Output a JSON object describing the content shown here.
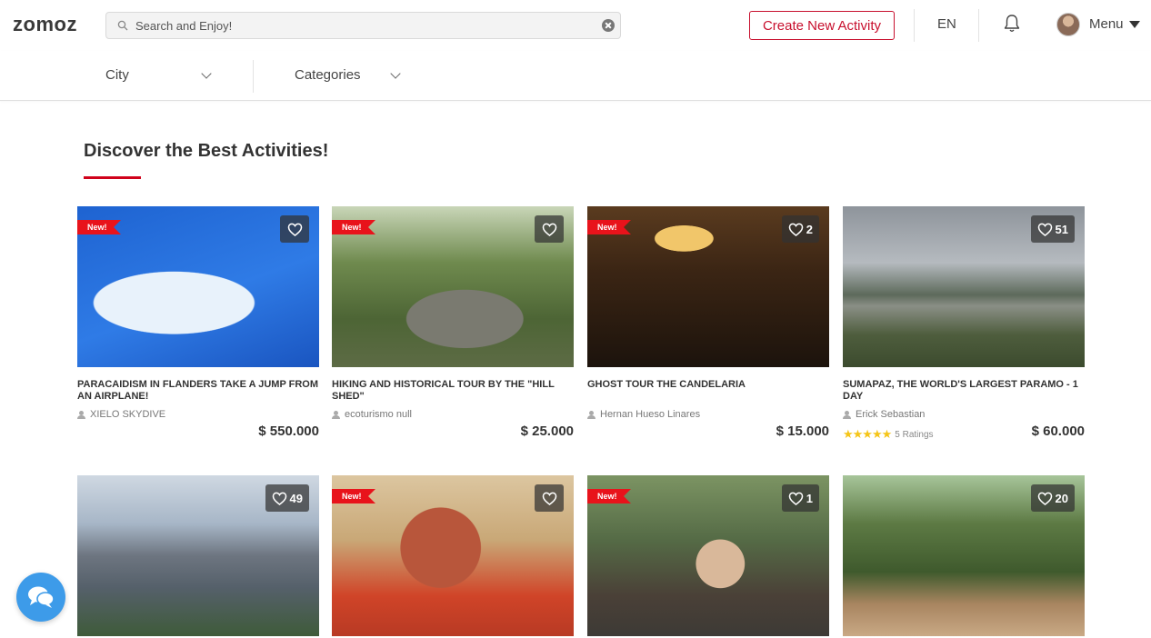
{
  "header": {
    "logo": "zomoz",
    "search_placeholder": "Search and Enjoy!",
    "create_button": "Create New Activity",
    "language": "EN",
    "menu_label": "Menu"
  },
  "filters": {
    "city": "City",
    "categories": "Categories"
  },
  "section": {
    "title": "Discover the Best Activities!",
    "accent": "#d0021b"
  },
  "colors": {
    "brand_red": "#c8102e",
    "new_badge": "#e8131b",
    "star": "#f5c518",
    "chat": "#3d9be9"
  },
  "cards": [
    {
      "new": "New!",
      "likes": "",
      "title": "PARACAIDISM IN FLANDERS TAKE A JUMP FROM AN AIRPLANE!",
      "host": "XIELO SKYDIVE",
      "price": "$ 550.000",
      "rating": "",
      "image": "skydiving-airplane"
    },
    {
      "new": "New!",
      "likes": "",
      "title": "HIKING AND HISTORICAL TOUR BY THE \"HILL SHED\"",
      "host": "ecoturismo null",
      "price": "$ 25.000",
      "rating": "",
      "image": "forest-rocks"
    },
    {
      "new": "New!",
      "likes": "2",
      "title": "GHOST TOUR THE CANDELARIA",
      "host": "Hernan Hueso Linares",
      "price": "$ 15.000",
      "rating": "",
      "image": "ghost-tour-dinner"
    },
    {
      "new": "",
      "likes": "51",
      "title": "SUMAPAZ, THE WORLD'S LARGEST PARAMO - 1 DAY",
      "host": "Erick Sebastian",
      "price": "$ 60.000",
      "rating": "5 Ratings",
      "stars": "★★★★★",
      "image": "paramo-lake"
    },
    {
      "new": "",
      "likes": "49",
      "title": "",
      "host": "",
      "price": "",
      "rating": "",
      "image": "rock-cliff"
    },
    {
      "new": "New!",
      "likes": "",
      "title": "",
      "host": "",
      "price": "",
      "rating": "",
      "image": "wayuu-woman"
    },
    {
      "new": "New!",
      "likes": "1",
      "title": "",
      "host": "",
      "price": "",
      "rating": "",
      "image": "monkeys-bridge"
    },
    {
      "new": "",
      "likes": "20",
      "title": "",
      "host": "",
      "price": "",
      "rating": "",
      "image": "wooden-walkway"
    }
  ]
}
